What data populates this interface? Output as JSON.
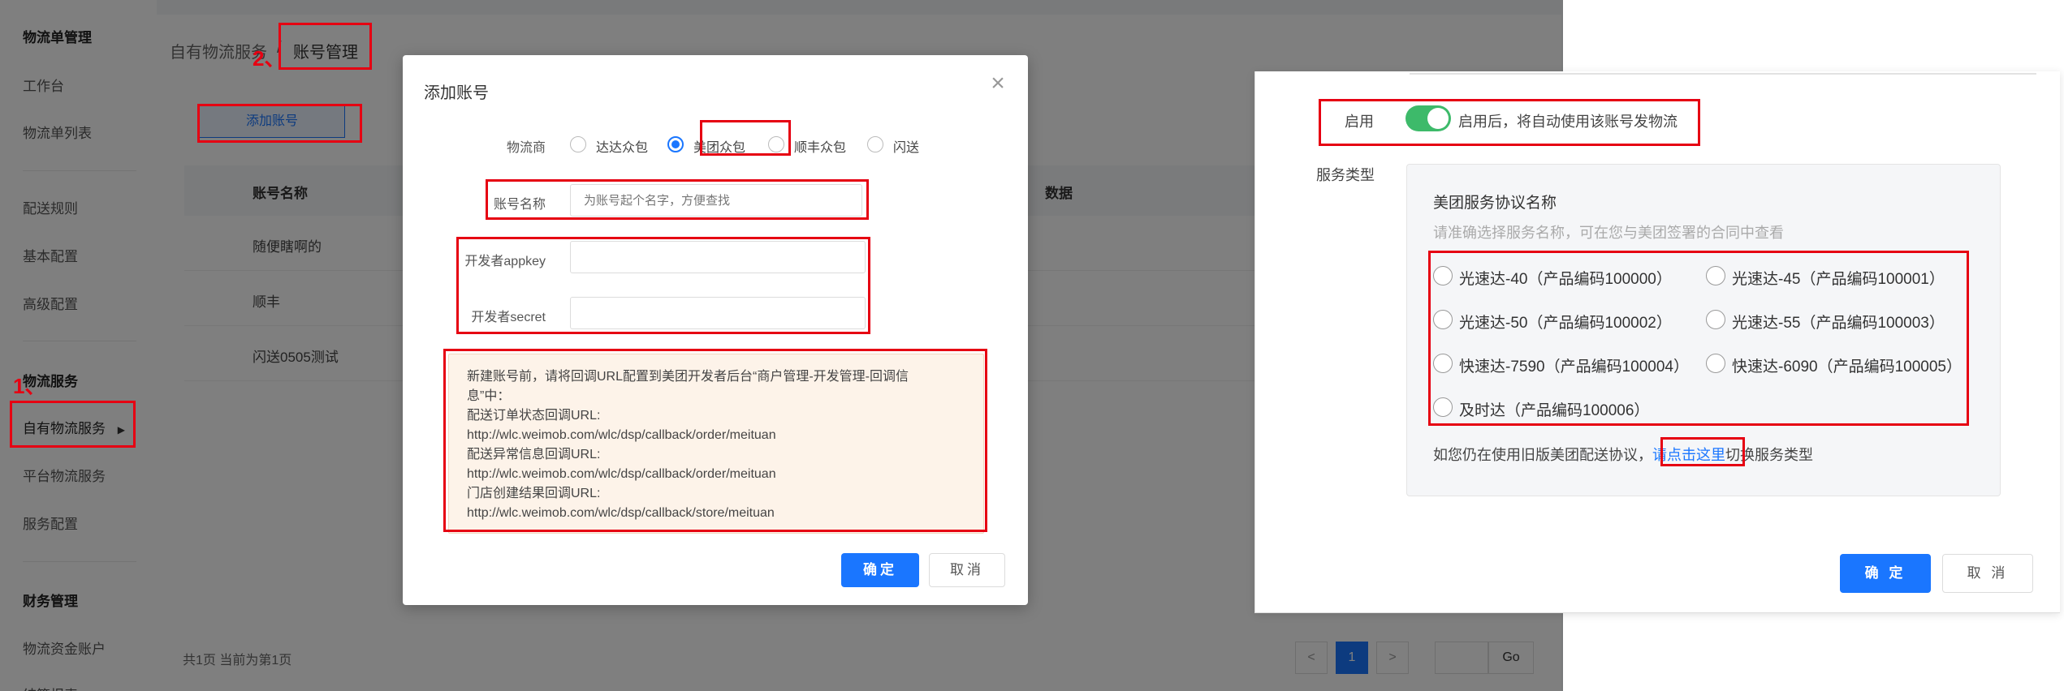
{
  "sidebar": {
    "items": [
      {
        "label": "物流单管理",
        "group": true
      },
      {
        "label": "工作台"
      },
      {
        "label": "物流单列表"
      },
      {
        "label": "配送规则"
      },
      {
        "label": "基本配置"
      },
      {
        "label": "高级配置"
      },
      {
        "label": "物流服务",
        "group": true
      },
      {
        "label": "自有物流服务"
      },
      {
        "label": "平台物流服务"
      },
      {
        "label": "服务配置"
      },
      {
        "label": "财务管理",
        "group": true
      },
      {
        "label": "物流资金账户"
      },
      {
        "label": "结算报表"
      }
    ],
    "active_arrow": "▶"
  },
  "breadcrumb": {
    "parent": "自有物流服务",
    "separator": "/",
    "current": "账号管理"
  },
  "toolbar": {
    "add_account": "添加账号"
  },
  "table": {
    "columns": [
      "账号名称",
      "数据"
    ],
    "rows": [
      "随便瞎啊的",
      "顺丰",
      "闪送0505测试"
    ]
  },
  "pager": {
    "summary": "共1页 当前为第1页",
    "prev": "<",
    "current": "1",
    "next": ">",
    "go": "Go"
  },
  "annotations": {
    "n1": "1、",
    "n2": "2、"
  },
  "modal": {
    "title": "添加账号",
    "close": "×",
    "carrier_label": "物流商",
    "carriers": [
      "达达众包",
      "美团众包",
      "顺丰众包",
      "闪送"
    ],
    "selected_carrier": "美团众包",
    "account_name_label": "账号名称",
    "account_name_placeholder": "为账号起个名字，方便查找",
    "appkey_label": "开发者appkey",
    "secret_label": "开发者secret",
    "notice_lines": [
      "新建账号前，请将回调URL配置到美团开发者后台“商户管理-开发管理-回调信",
      "息”中：",
      "配送订单状态回调URL:",
      "http://wlc.weimob.com/wlc/dsp/callback/order/meituan",
      "配送异常信息回调URL:",
      "http://wlc.weimob.com/wlc/dsp/callback/order/meituan",
      "门店创建结果回调URL:",
      "http://wlc.weimob.com/wlc/dsp/callback/store/meituan"
    ],
    "ok": "确定",
    "cancel": "取消"
  },
  "right_panel": {
    "enable_label": "启用",
    "enable_on": true,
    "enable_text": "启用后，将自动使用该账号发物流",
    "service_label": "服务类型",
    "sub_title": "美团服务协议名称",
    "sub_hint": "请准确选择服务名称，可在您与美团签署的合同中查看",
    "options": [
      "光速达-40（产品编码100000）",
      "光速达-45（产品编码100001）",
      "光速达-50（产品编码100002）",
      "光速达-55（产品编码100003）",
      "快速达-7590（产品编码100004）",
      "快速达-6090（产品编码100005）",
      "及时达（产品编码100006）"
    ],
    "switch_prefix": "如您仍在使用旧版美团配送协议，",
    "switch_link": "请点击这里",
    "switch_suffix": "切换服务类型",
    "ok": "确 定",
    "cancel": "取 消"
  },
  "colors": {
    "primary": "#1a76ff",
    "annotation_red": "#e60012",
    "switch_green": "#3dba6a",
    "notice_bg": "#fdf3e9"
  }
}
